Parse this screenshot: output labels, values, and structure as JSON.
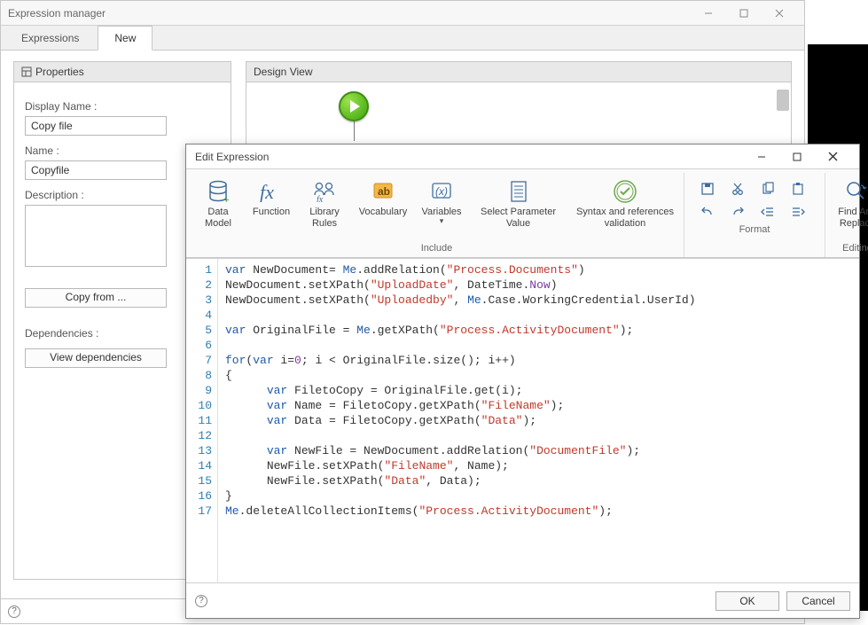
{
  "em": {
    "title": "Expression manager",
    "tabs": {
      "expressions": "Expressions",
      "new": "New"
    },
    "properties": {
      "header": "Properties",
      "display_name_lbl": "Display Name :",
      "display_name": "Copy file",
      "name_lbl": "Name :",
      "name": "Copyfile",
      "description_lbl": "Description :",
      "description": "",
      "copy_from_btn": "Copy from ...",
      "dependencies_lbl": "Dependencies :",
      "view_deps_btn": "View dependencies"
    },
    "design_header": "Design View"
  },
  "ee": {
    "title": "Edit Expression",
    "ribbon": {
      "include_group": "Include",
      "format_group": "Format",
      "editing_group": "Editing",
      "data_model": "Data\nModel",
      "function": "Function",
      "library_rules": "Library\nRules",
      "vocabulary": "Vocabulary",
      "variables": "Variables",
      "select_param": "Select Parameter\nValue",
      "syntax": "Syntax and references\nvalidation",
      "find_replace": "Find And\nReplace"
    },
    "buttons": {
      "ok": "OK",
      "cancel": "Cancel"
    },
    "line_count": 17
  },
  "code": {
    "l1": {
      "a": "var",
      "b": " NewDocument= ",
      "c": "Me",
      "d": ".addRelation(",
      "e": "\"Process.Documents\"",
      "f": ")"
    },
    "l2": {
      "a": "NewDocument.setXPath(",
      "b": "\"UploadDate\"",
      "c": ", DateTime.",
      "d": "Now",
      "e": ")"
    },
    "l3": {
      "a": "NewDocument.setXPath(",
      "b": "\"Uploadedby\"",
      "c": ", ",
      "d": "Me",
      "e": ".Case.WorkingCredential.UserId)"
    },
    "l5": {
      "a": "var",
      "b": " OriginalFile = ",
      "c": "Me",
      "d": ".getXPath(",
      "e": "\"Process.ActivityDocument\"",
      "f": ");"
    },
    "l7": {
      "a": "for",
      "b": "(",
      "c": "var",
      "d": " i=",
      "e": "0",
      "f": "; i < OriginalFile.size(); i++)"
    },
    "l8": "{",
    "l9": {
      "a": "var",
      "b": " FiletoCopy = OriginalFile.get(i);"
    },
    "l10": {
      "a": "var",
      "b": " Name = FiletoCopy.getXPath(",
      "c": "\"FileName\"",
      "d": ");"
    },
    "l11": {
      "a": "var",
      "b": " Data = FiletoCopy.getXPath(",
      "c": "\"Data\"",
      "d": ");"
    },
    "l13": {
      "a": "var",
      "b": " NewFile = NewDocument.addRelation(",
      "c": "\"DocumentFile\"",
      "d": ");"
    },
    "l14": {
      "a": "NewFile.setXPath(",
      "b": "\"FileName\"",
      "c": ", Name);"
    },
    "l15": {
      "a": "NewFile.setXPath(",
      "b": "\"Data\"",
      "c": ", Data);"
    },
    "l16": "}",
    "l17": {
      "a": "Me",
      "b": ".deleteAllCollectionItems(",
      "c": "\"Process.ActivityDocument\"",
      "d": ");"
    }
  }
}
